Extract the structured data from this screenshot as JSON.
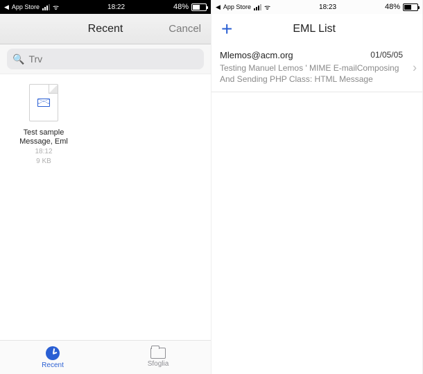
{
  "left": {
    "status": {
      "back": "App Store",
      "time": "18:22",
      "pct": "48%"
    },
    "nav": {
      "title": "Recent",
      "cancel": "Cancel"
    },
    "search": {
      "placeholder": "Trv"
    },
    "file": {
      "name": "Test sample Message, Eml",
      "time": "18:12",
      "size": "9 KB"
    },
    "tabs": {
      "recent": "Recent",
      "browse": "Sfoglia"
    }
  },
  "right": {
    "status": {
      "back": "App Store",
      "time": "18:23",
      "pct": "48%"
    },
    "nav": {
      "title": "EML List"
    },
    "eml": {
      "from": "Mlemos@acm.org",
      "date": "01/05/05",
      "subject": "Testing Manuel Lemos ' MIME E-mailComposing And Sending PHP Class: HTML Message"
    }
  }
}
